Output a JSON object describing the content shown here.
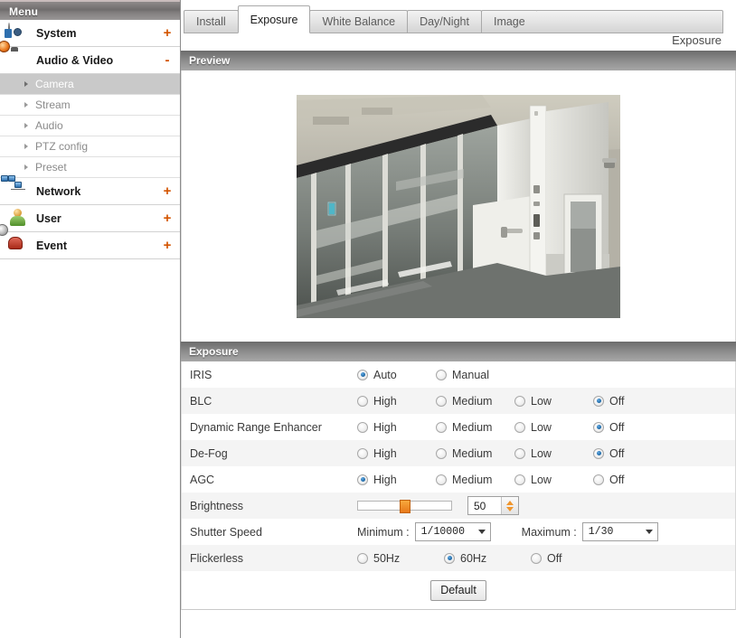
{
  "sidebar": {
    "header": "Menu",
    "items": [
      {
        "label": "System",
        "icon": "gear-icon",
        "expander": "+",
        "expanded": false
      },
      {
        "label": "Audio & Video",
        "icon": "camera-icon",
        "expander": "-",
        "expanded": true,
        "children": [
          {
            "label": "Camera",
            "active": true
          },
          {
            "label": "Stream",
            "active": false
          },
          {
            "label": "Audio",
            "active": false
          },
          {
            "label": "PTZ config",
            "active": false
          },
          {
            "label": "Preset",
            "active": false
          }
        ]
      },
      {
        "label": "Network",
        "icon": "network-icon",
        "expander": "+",
        "expanded": false
      },
      {
        "label": "User",
        "icon": "user-icon",
        "expander": "+",
        "expanded": false
      },
      {
        "label": "Event",
        "icon": "event-icon",
        "expander": "+",
        "expanded": false
      }
    ]
  },
  "tabs": [
    {
      "label": "Install",
      "active": false
    },
    {
      "label": "Exposure",
      "active": true
    },
    {
      "label": "White Balance",
      "active": false
    },
    {
      "label": "Day/Night",
      "active": false
    },
    {
      "label": "Image",
      "active": false
    }
  ],
  "breadcrumb": "Exposure",
  "preview": {
    "title": "Preview"
  },
  "exposure": {
    "title": "Exposure",
    "rows": [
      {
        "label": "IRIS",
        "type": "radio",
        "options": [
          {
            "label": "Auto",
            "selected": true
          },
          {
            "label": "Manual",
            "selected": false
          }
        ]
      },
      {
        "label": "BLC",
        "type": "radio",
        "options": [
          {
            "label": "High",
            "selected": false
          },
          {
            "label": "Medium",
            "selected": false
          },
          {
            "label": "Low",
            "selected": false
          },
          {
            "label": "Off",
            "selected": true
          }
        ]
      },
      {
        "label": "Dynamic Range Enhancer",
        "type": "radio",
        "options": [
          {
            "label": "High",
            "selected": false
          },
          {
            "label": "Medium",
            "selected": false
          },
          {
            "label": "Low",
            "selected": false
          },
          {
            "label": "Off",
            "selected": true
          }
        ]
      },
      {
        "label": "De-Fog",
        "type": "radio",
        "options": [
          {
            "label": "High",
            "selected": false
          },
          {
            "label": "Medium",
            "selected": false
          },
          {
            "label": "Low",
            "selected": false
          },
          {
            "label": "Off",
            "selected": true
          }
        ]
      },
      {
        "label": "AGC",
        "type": "radio",
        "options": [
          {
            "label": "High",
            "selected": true
          },
          {
            "label": "Medium",
            "selected": false
          },
          {
            "label": "Low",
            "selected": false
          },
          {
            "label": "Off",
            "selected": false
          }
        ]
      },
      {
        "label": "Brightness",
        "type": "slider",
        "value": "50",
        "slider_percent": 45,
        "min": "0",
        "max": "100"
      },
      {
        "label": "Shutter Speed",
        "type": "selects",
        "selects": [
          {
            "label": "Minimum :",
            "value": "1/10000"
          },
          {
            "label": "Maximum :",
            "value": "1/30"
          }
        ]
      },
      {
        "label": "Flickerless",
        "type": "radio",
        "options": [
          {
            "label": "50Hz",
            "selected": false
          },
          {
            "label": "60Hz",
            "selected": true
          },
          {
            "label": "Off",
            "selected": false
          }
        ]
      }
    ],
    "default_button": "Default"
  },
  "colors": {
    "accent_orange": "#d35400",
    "radio_blue": "#14619f",
    "slider_orange": "#e8791a",
    "panel_header_gray": "#8d8d8d",
    "active_submenu_bg": "#c9c9c9"
  }
}
